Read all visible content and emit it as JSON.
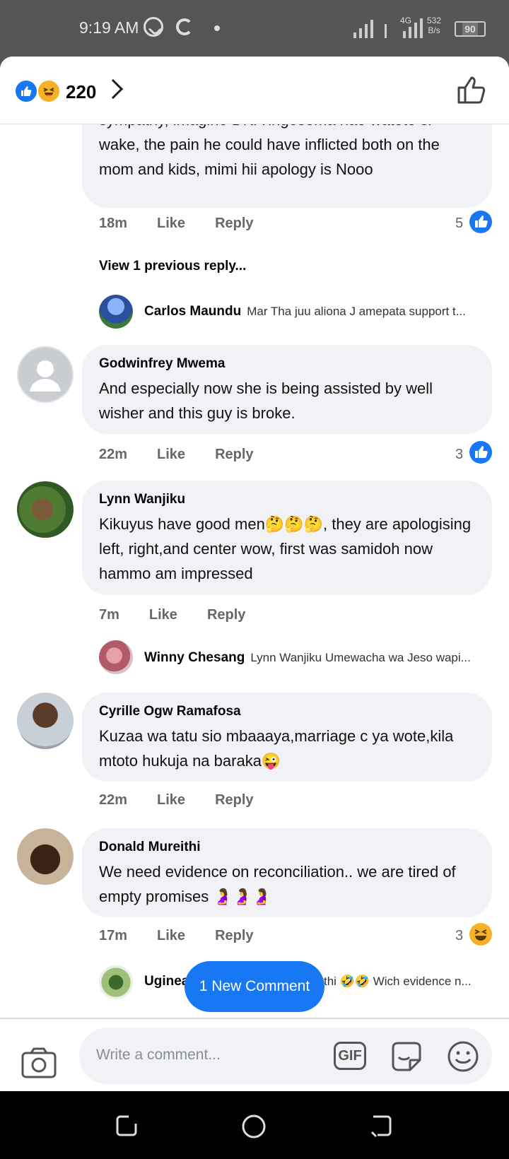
{
  "status": {
    "time": "9:19 AM",
    "network": "4G",
    "speed_value": "532",
    "speed_unit": "B/s",
    "battery": "90"
  },
  "header": {
    "reaction_count": "220",
    "reactions": [
      "like-icon",
      "haha-icon"
    ]
  },
  "top_comment": {
    "text": "sympathy,  imagine DNA ingesema hao watoto si wake, the pain he could have inflicted both on the mom and kids, mimi hii apology is Nooo",
    "time": "18m",
    "like": "Like",
    "reply": "Reply",
    "reactions": "5",
    "view_previous": "View 1 previous reply...",
    "reply_preview": {
      "name": "Carlos Maundu",
      "text": "Mar Tha juu aliona J amepata support t..."
    }
  },
  "comments": [
    {
      "name": "Godwinfrey Mwema",
      "text": "And especially now she is being assisted by well wisher and this guy is broke.",
      "time": "22m",
      "like": "Like",
      "reply": "Reply",
      "reactions": "3"
    },
    {
      "name": "Lynn Wanjiku",
      "text": "Kikuyus have good men🤔🤔🤔, they are apologising left, right,and center wow, first was samidoh now hammo am impressed",
      "time": "7m",
      "like": "Like",
      "reply": "Reply",
      "reply_preview": {
        "name": "Winny Chesang",
        "text": "Lynn Wanjiku Umewacha wa Jeso wapi..."
      }
    },
    {
      "name": "Cyrille Ogw Ramafosa",
      "text": "Kuzaa wa tatu sio mbaaaya,marriage c ya wote,kila mtoto hukuja na baraka😜",
      "time": "22m",
      "like": "Like",
      "reply": "Reply"
    },
    {
      "name": "Donald Mureithi",
      "text": "We need evidence on reconciliation.. we are tired of empty promises 🤰🤰🤰",
      "time": "17m",
      "like": "Like",
      "reply": "Reply",
      "reactions": "3",
      "reply_preview": {
        "name": "Uginea",
        "text": "thi 🤣🤣 Wich evidence n..."
      }
    }
  ],
  "new_comment_button": "1 New Comment",
  "composer": {
    "placeholder": "Write a comment...",
    "gif_label": "GIF"
  },
  "colors": {
    "accent": "#1877f2",
    "bubble": "#f0f2f5",
    "haha": "#f7b125"
  }
}
